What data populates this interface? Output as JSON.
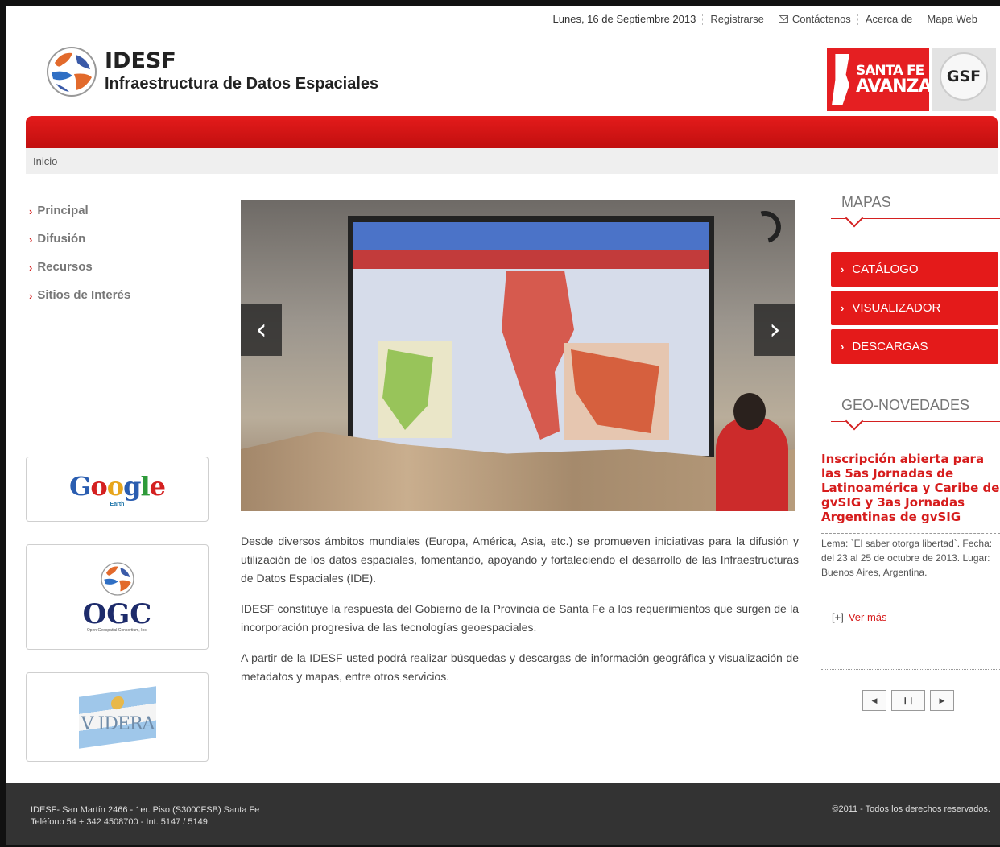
{
  "topnav": {
    "date": "Lunes, 16 de Septiembre 2013",
    "links": [
      "Registrarse",
      "Contáctenos",
      "Acerca de",
      "Mapa Web"
    ]
  },
  "logo": {
    "title": "IDESF",
    "subtitle": "Infraestructura de Datos Espaciales"
  },
  "partner_logos": {
    "santa_fe_line1": "SANTA FE",
    "santa_fe_line2": "AVANZA",
    "gsf": "GSF"
  },
  "breadcrumb": "Inicio",
  "left_menu": [
    "Principal",
    "Difusión",
    "Recursos",
    "Sitios de Interés"
  ],
  "partners": {
    "google": "Google",
    "google_sub": "Earth",
    "ogc": "OGC",
    "ogc_sub": "Open Geospatial Consortium, Inc.",
    "idera": "V IDERA"
  },
  "main_text": [
    "Desde diversos ámbitos mundiales (Europa, América, Asia, etc.) se promueven iniciativas para la difusión y utilización de los datos espaciales, fomentando, apoyando y fortaleciendo el desarrollo de las Infraestructuras de Datos Espaciales (IDE).",
    "IDESF constituye la respuesta del Gobierno de la Provincia de Santa Fe a los requerimientos que surgen de la incorporación progresiva de las tecnologías geoespaciales.",
    "A partir de la IDESF usted podrá realizar búsquedas y descargas de información geográfica y visualización de metadatos y mapas, entre otros servicios."
  ],
  "mapas": {
    "title": "MAPAS",
    "buttons": [
      "CATÁLOGO",
      "VISUALIZADOR",
      "DESCARGAS"
    ]
  },
  "geo_novedades": {
    "title": "GEO-NOVEDADES",
    "headline": "Inscripción abierta para las 5as Jornadas de Latinoamérica y Caribe de gvSIG y 3as Jornadas Argentinas de gvSIG",
    "body": "Lema: `El saber otorga libertad`. Fecha: del 23 al 25 de octubre de 2013. Lugar: Buenos Aires, Argentina.",
    "more_prefix": "[+]",
    "more_label": "Ver más"
  },
  "footer": {
    "address_line1": "IDESF- San Martín 2466 - 1er. Piso (S3000FSB) Santa Fe",
    "address_line2": "Teléfono 54 + 342 4508700 - Int. 5147 / 5149.",
    "copyright": "©2011 - Todos los derechos reservados."
  },
  "colors": {
    "accent": "#e41a1a",
    "footer": "#333333"
  }
}
